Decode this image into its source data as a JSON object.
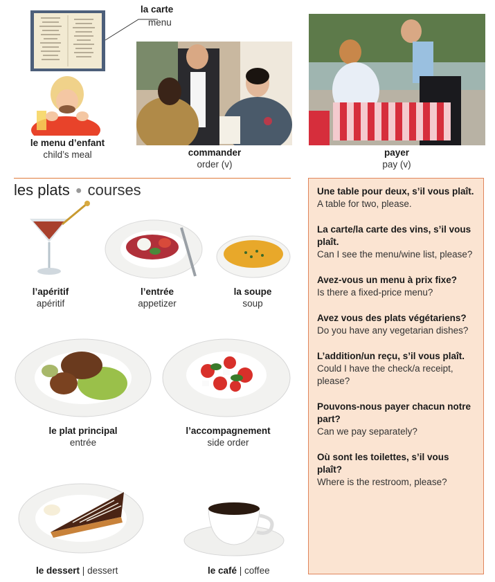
{
  "top": {
    "carte": {
      "fr": "la carte",
      "en": "menu"
    },
    "menu_enfant": {
      "fr": "le menu d’enfant",
      "en": "child’s meal"
    },
    "commander": {
      "fr": "commander",
      "en": "order (v)"
    },
    "payer": {
      "fr": "payer",
      "en": "pay (v)"
    }
  },
  "section": {
    "title": "les plats",
    "subtitle": "courses"
  },
  "courses": {
    "aperitif": {
      "fr": "l’apéritif",
      "en": "apéritif"
    },
    "entree": {
      "fr": "l’entrée",
      "en": "appetizer"
    },
    "soupe": {
      "fr": "la soupe",
      "en": "soup"
    },
    "plat": {
      "fr": "le plat principal",
      "en": "entrée"
    },
    "accomp": {
      "fr": "l’accompagnement",
      "en": "side order"
    },
    "dessert": {
      "fr": "le dessert",
      "en": "dessert"
    },
    "cafe": {
      "fr": "le café",
      "en": "coffee"
    }
  },
  "phrases": [
    {
      "q": "Une table pour deux, s’il vous plaît.",
      "a": "A table for two, please."
    },
    {
      "q": "La carte/la carte des vins, s’il vous plaît.",
      "a": "Can I see the menu/wine list, please?"
    },
    {
      "q": "Avez-vous un menu à prix fixe?",
      "a": "Is there a fixed-price menu?"
    },
    {
      "q": "Avez vous des plats végétariens?",
      "a": "Do you have any vegetarian dishes?"
    },
    {
      "q": "L’addition/un reçu, s’il vous plaît.",
      "a": "Could I have the check/a receipt, please?"
    },
    {
      "q": "Pouvons-nous payer chacun notre part?",
      "a": "Can we pay separately?"
    },
    {
      "q": "Où sont les toilettes, s’il vous plaît?",
      "a": "Where is the restroom, please?"
    }
  ]
}
